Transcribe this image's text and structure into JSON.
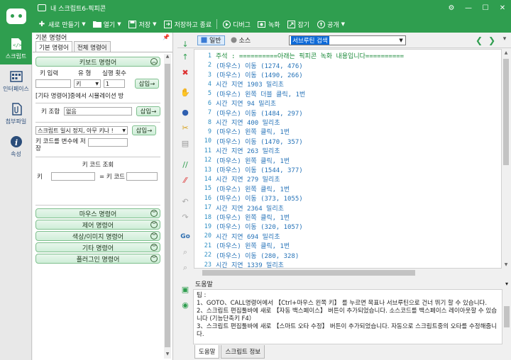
{
  "window": {
    "title": "내 스크립트6-픽피콘",
    "controls": {
      "settings": "⚙",
      "minimize": "—",
      "maximize": "☐",
      "close": "✕"
    }
  },
  "toolbar": {
    "new_label": "새로 만들기",
    "open_label": "열기",
    "save_label": "저장",
    "save_exit_label": "저장하고 종료",
    "debug_label": "디버그",
    "record_label": "녹화",
    "capture_label": "잡기",
    "share_label": "공개"
  },
  "rail": {
    "items": [
      {
        "label": "스크립트",
        "icon": "script-icon",
        "active": true
      },
      {
        "label": "인터페이스",
        "icon": "interface-icon",
        "active": false
      },
      {
        "label": "첨부파일",
        "icon": "attachment-icon",
        "active": false
      },
      {
        "label": "속성",
        "icon": "info-icon",
        "active": false
      }
    ]
  },
  "panel": {
    "header": "기본 명령어",
    "tabs": [
      "기본 명령어",
      "전체 명령어"
    ],
    "keyboard_group": "키보드 명령어",
    "key_input_label": "키 입력",
    "type_label": "유 형",
    "repeat_label": "실행 횟수",
    "type_value": "키",
    "repeat_value": "1",
    "insert_label": "삽입→",
    "sim_text": "[기타 명령어]중에서 시뮬레이션 방",
    "key_combo_label": "키 조합",
    "key_combo_value": "없음",
    "pause_option": "스크립트 일시 정지, 아무 키나 !",
    "save_key_label": "키 코드를 변수에 저장",
    "key_code_lookup": "키 코드 조회",
    "key_label": "키",
    "key_code_label": "= 키 코드",
    "groups": [
      "마우스 명령어",
      "제어 명령어",
      "색상/이미지 명령어",
      "기타 명령어",
      "플러그인 명령어"
    ]
  },
  "editor": {
    "mode_normal": "일반",
    "mode_source": "소스",
    "subroutine_value": "서브루틴 검색",
    "lines": [
      {
        "n": "1",
        "text": "주석 : ==========아래는 픽피콘 녹화 내용입니다==========",
        "comment": true
      },
      {
        "n": "2",
        "text": "(마우스) 이동 (1274, 476)",
        "comment": false
      },
      {
        "n": "3",
        "text": "(마우스) 이동 (1490, 266)",
        "comment": false
      },
      {
        "n": "4",
        "text": "시간 지연 1903 밀리초",
        "comment": false
      },
      {
        "n": "5",
        "text": "(마우스) 왼쪽 더블 클릭, 1번",
        "comment": false
      },
      {
        "n": "6",
        "text": "시간 지연 94 밀리초",
        "comment": false
      },
      {
        "n": "7",
        "text": "(마우스) 이동 (1484, 297)",
        "comment": false
      },
      {
        "n": "8",
        "text": "시간 지연 400 밀리초",
        "comment": false
      },
      {
        "n": "9",
        "text": "(마우스) 왼쪽 클릭, 1번",
        "comment": false
      },
      {
        "n": "10",
        "text": "(마우스) 이동 (1470, 357)",
        "comment": false
      },
      {
        "n": "11",
        "text": "시간 지연 263 밀리초",
        "comment": false
      },
      {
        "n": "12",
        "text": "(마우스) 왼쪽 클릭, 1번",
        "comment": false
      },
      {
        "n": "13",
        "text": "(마우스) 이동 (1544, 377)",
        "comment": false
      },
      {
        "n": "14",
        "text": "시간 지연 279 밀리초",
        "comment": false
      },
      {
        "n": "15",
        "text": "(마우스) 왼쪽 클릭, 1번",
        "comment": false
      },
      {
        "n": "16",
        "text": "(마우스) 이동 (373, 1055)",
        "comment": false
      },
      {
        "n": "17",
        "text": "시간 지연 2364 밀리초",
        "comment": false
      },
      {
        "n": "18",
        "text": "(마우스) 왼쪽 클릭, 1번",
        "comment": false
      },
      {
        "n": "19",
        "text": "(마우스) 이동 (320, 1057)",
        "comment": false
      },
      {
        "n": "20",
        "text": "시간 지연 694 밀리초",
        "comment": false
      },
      {
        "n": "21",
        "text": "(마우스) 왼쪽 클릭, 1번",
        "comment": false
      },
      {
        "n": "22",
        "text": "(마우스) 이동 (280, 328)",
        "comment": false
      },
      {
        "n": "23",
        "text": "시간 지연 1339 밀리초",
        "comment": false
      }
    ]
  },
  "help": {
    "title": "도움말",
    "lines": [
      "팁 :",
      "1、GOTO、CALL명령어에서 【Ctrl+마우스 왼쪽 키】 를 누르면 목표나 서브루틴으로 건너 뛰기 할 수 있습니다.",
      "2、스크립트 편집툴바에 새로 【자동 백스페이스】 버튼이 추가되었습니다. 소스코드를 백스페이스 레이아웃할 수 있습니다 (기능단축키 F4）",
      "3、스크립트 편집툴바에 새로 【스마트 오타 수정】 버튼이 추가되었습니다. 자동으로 스크립트중의 오타를 수정해줍니다."
    ],
    "tabs": [
      "도움말",
      "스크립트 정보"
    ]
  },
  "colors": {
    "brand": "#2f9e4f",
    "code_blue": "#2673b8",
    "comment_green": "#1b8a3a"
  }
}
